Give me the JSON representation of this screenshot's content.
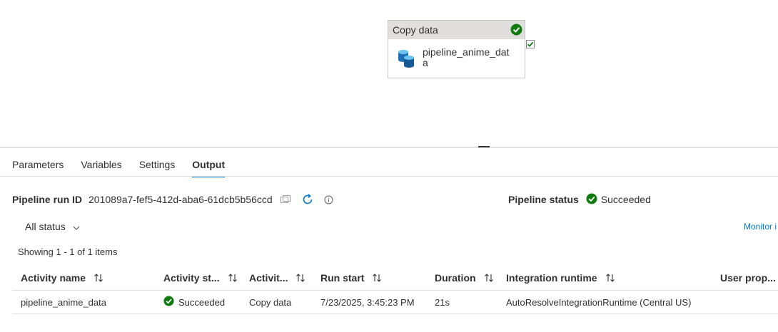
{
  "canvas": {
    "activity": {
      "type_label": "Copy data",
      "name": "pipeline_anime_data"
    }
  },
  "tabs": [
    {
      "label": "Parameters",
      "active": false
    },
    {
      "label": "Variables",
      "active": false
    },
    {
      "label": "Settings",
      "active": false
    },
    {
      "label": "Output",
      "active": true
    }
  ],
  "run": {
    "label": "Pipeline run ID",
    "id": "201089a7-fef5-412d-aba6-61dcb5b56ccd",
    "status_label": "Pipeline status",
    "status_value": "Succeeded"
  },
  "filter": {
    "label": "All status"
  },
  "monitor_link": "Monitor i",
  "showing": "Showing 1 - 1 of 1 items",
  "table": {
    "columns": [
      "Activity name",
      "Activity st...",
      "Activit...",
      "Run start",
      "Duration",
      "Integration runtime",
      "User prop..."
    ],
    "rows": [
      {
        "activity_name": "pipeline_anime_data",
        "status": "Succeeded",
        "type": "Copy data",
        "run_start": "7/23/2025, 3:45:23 PM",
        "duration": "21s",
        "runtime": "AutoResolveIntegrationRuntime (Central US)",
        "user_props": ""
      }
    ]
  },
  "colors": {
    "accent": "#0078d4",
    "success": "#107c10"
  }
}
